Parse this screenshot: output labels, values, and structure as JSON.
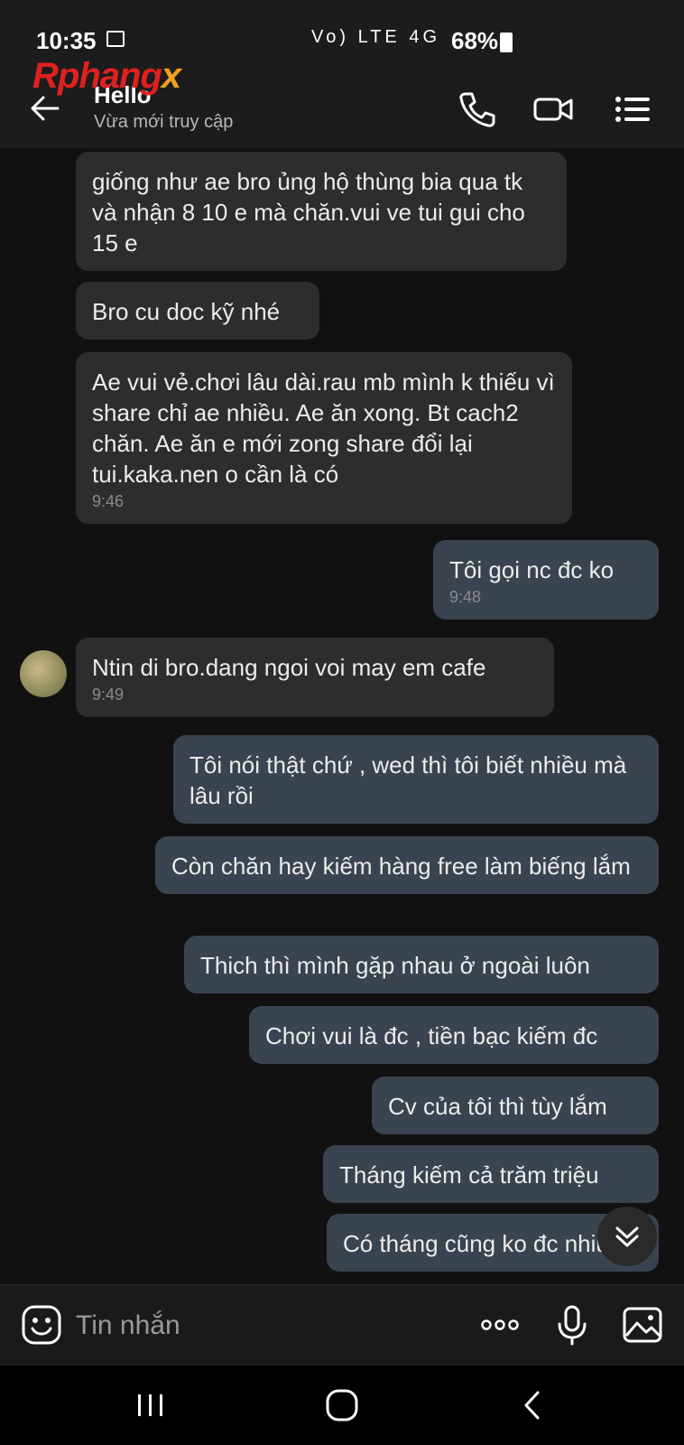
{
  "status_bar": {
    "time": "10:35",
    "network_icons": "Vo) LTE 4G",
    "battery": "68%"
  },
  "watermark": {
    "text": "Rphang",
    "suffix": "x"
  },
  "header": {
    "contact_name": "Hello",
    "presence": "Vừa mới truy cập"
  },
  "messages": [
    {
      "dir": "in",
      "text": "giống như ae bro ủng hộ thùng bia qua tk và nhận 8 10 e mà chăn.vui ve tui gui cho 15 e",
      "time": ""
    },
    {
      "dir": "in",
      "text": "Bro cu doc kỹ nhé",
      "time": ""
    },
    {
      "dir": "in",
      "text": "Ae vui vẻ.chơi lâu dài.rau mb mình k thiếu vì share chỉ ae nhiều. Ae ăn xong. Bt cach2 chăn. Ae ăn e mới zong share đổi lại tui.kaka.nen o cần là có",
      "time": "9:46"
    },
    {
      "dir": "out",
      "text": "Tôi gọi nc đc ko",
      "time": "9:48"
    },
    {
      "dir": "in",
      "text": "Ntin di bro.dang ngoi voi may em cafe",
      "time": "9:49"
    },
    {
      "dir": "out",
      "text": "Tôi nói thật chứ , wed thì tôi biết nhiều mà lâu rồi",
      "time": ""
    },
    {
      "dir": "out",
      "text": "Còn chăn hay kiếm hàng free làm biếng lắm",
      "time": ""
    },
    {
      "dir": "out",
      "text": "Thich thì mình gặp nhau ở ngoài luôn",
      "time": ""
    },
    {
      "dir": "out",
      "text": "Chơi vui là đc , tiền bạc kiếm đc",
      "time": ""
    },
    {
      "dir": "out",
      "text": "Cv của tôi thì tùy lắm",
      "time": ""
    },
    {
      "dir": "out",
      "text": "Tháng kiếm cả trăm triệu",
      "time": ""
    },
    {
      "dir": "out",
      "text": "Có tháng cũng ko đc nhiu",
      "time": ""
    }
  ],
  "input": {
    "placeholder": "Tin nhắn"
  },
  "colors": {
    "background": "#111111",
    "incoming_bubble": "#2d2d2d",
    "outgoing_bubble": "#3a4350",
    "header": "#1c1c1c"
  },
  "icons": [
    "back-arrow-icon",
    "phone-icon",
    "video-call-icon",
    "menu-icon",
    "emoji-icon",
    "more-icon",
    "microphone-icon",
    "image-icon",
    "scroll-down-icon",
    "recents-icon",
    "home-icon",
    "nav-back-icon"
  ]
}
